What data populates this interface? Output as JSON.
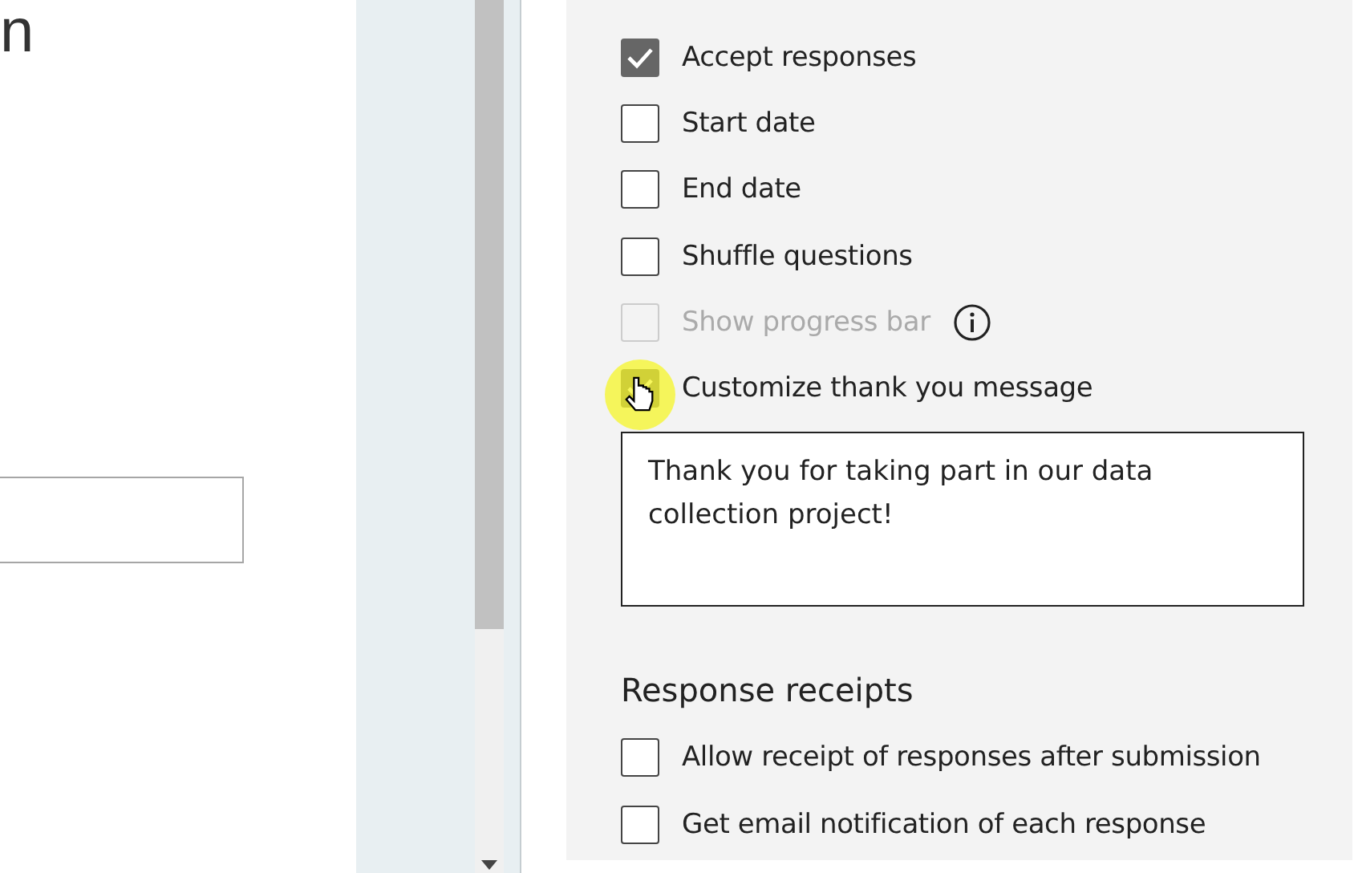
{
  "left_panel": {
    "heading": "n"
  },
  "options": [
    {
      "label": "Accept responses",
      "checked": true,
      "disabled": false,
      "info": false
    },
    {
      "label": "Start date",
      "checked": false,
      "disabled": false,
      "info": false
    },
    {
      "label": "End date",
      "checked": false,
      "disabled": false,
      "info": false
    },
    {
      "label": "Shuffle questions",
      "checked": false,
      "disabled": false,
      "info": false
    },
    {
      "label": "Show progress bar",
      "checked": false,
      "disabled": true,
      "info": true
    },
    {
      "label": "Customize thank you message",
      "checked": true,
      "disabled": false,
      "info": false
    }
  ],
  "thank_you_message": "Thank you for taking part in our data collection project!",
  "receipts": {
    "heading": "Response receipts",
    "options": [
      {
        "label": "Allow receipt of responses after submission",
        "checked": false,
        "disabled": false,
        "info": false
      },
      {
        "label": "Get email notification of each response",
        "checked": false,
        "disabled": false,
        "info": false
      }
    ]
  }
}
